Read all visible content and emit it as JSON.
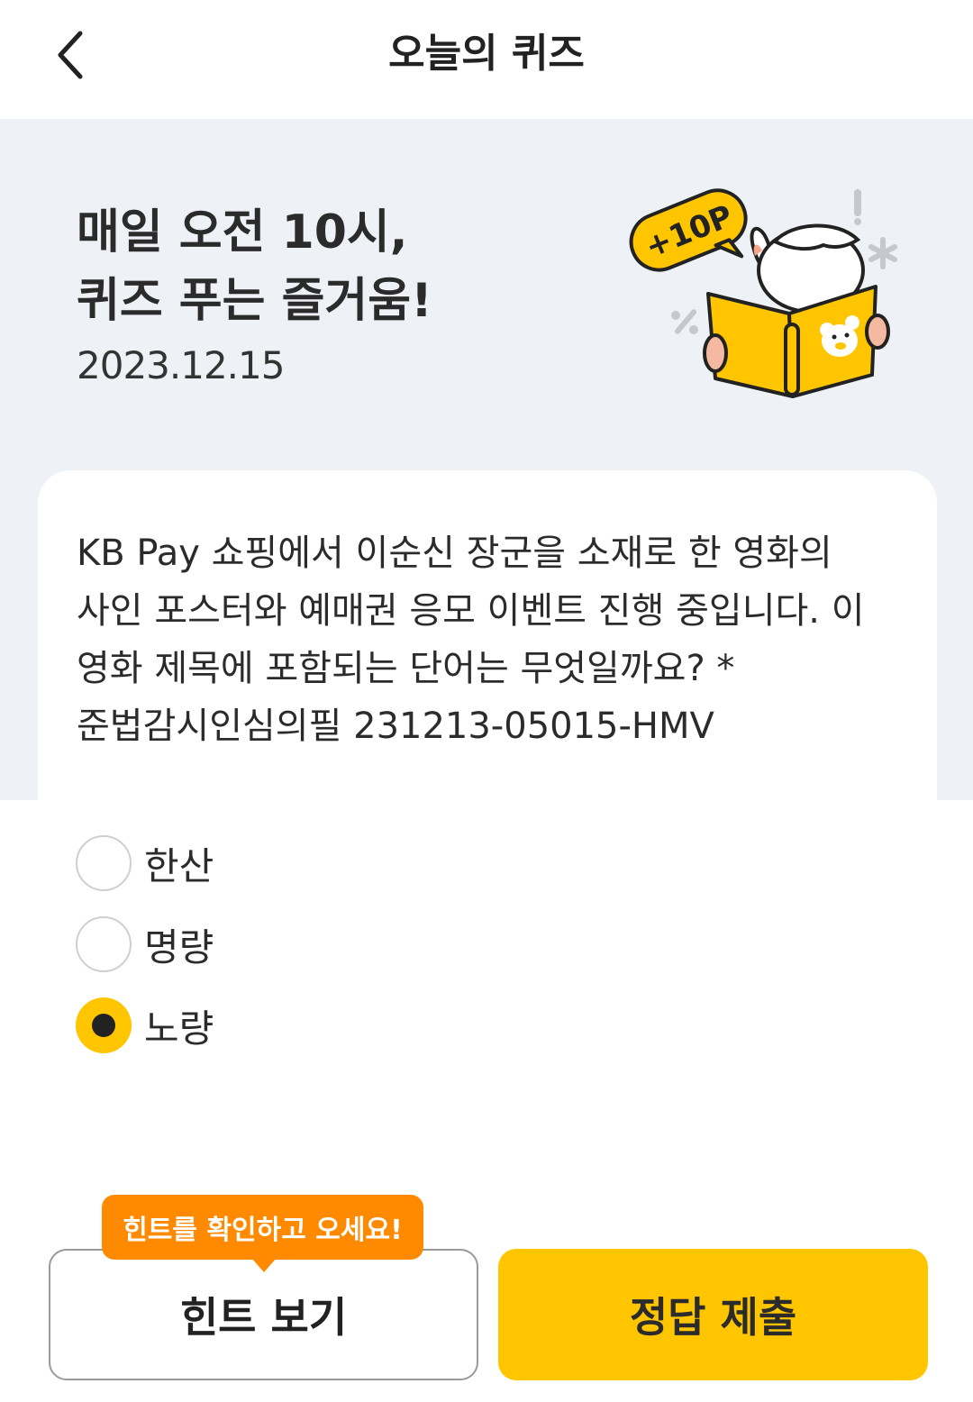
{
  "header": {
    "title": "오늘의 퀴즈",
    "back_icon": "chevron-left-icon"
  },
  "hero": {
    "title_line1": "매일 오전 10시,",
    "title_line2": "퀴즈 푸는 즐거움!",
    "date": "2023.12.15",
    "badge": "+10P"
  },
  "question": {
    "text": "KB Pay 쇼핑에서 이순신 장군을 소재로 한 영화의 사인 포스터와 예매권 응모 이벤트 진행 중입니다. 이 영화 제목에 포함되는 단어는 무엇일까요? *준법감시인심의필 231213-05015-HMV"
  },
  "options": [
    {
      "label": "한산",
      "selected": false
    },
    {
      "label": "명량",
      "selected": false
    },
    {
      "label": "노량",
      "selected": true
    }
  ],
  "tooltip": "힌트를 확인하고 오세요!",
  "buttons": {
    "hint": "힌트 보기",
    "submit": "정답 제출"
  },
  "colors": {
    "accent": "#ffc600",
    "tooltip": "#ff8a00",
    "hero_bg": "#eef1f6"
  }
}
